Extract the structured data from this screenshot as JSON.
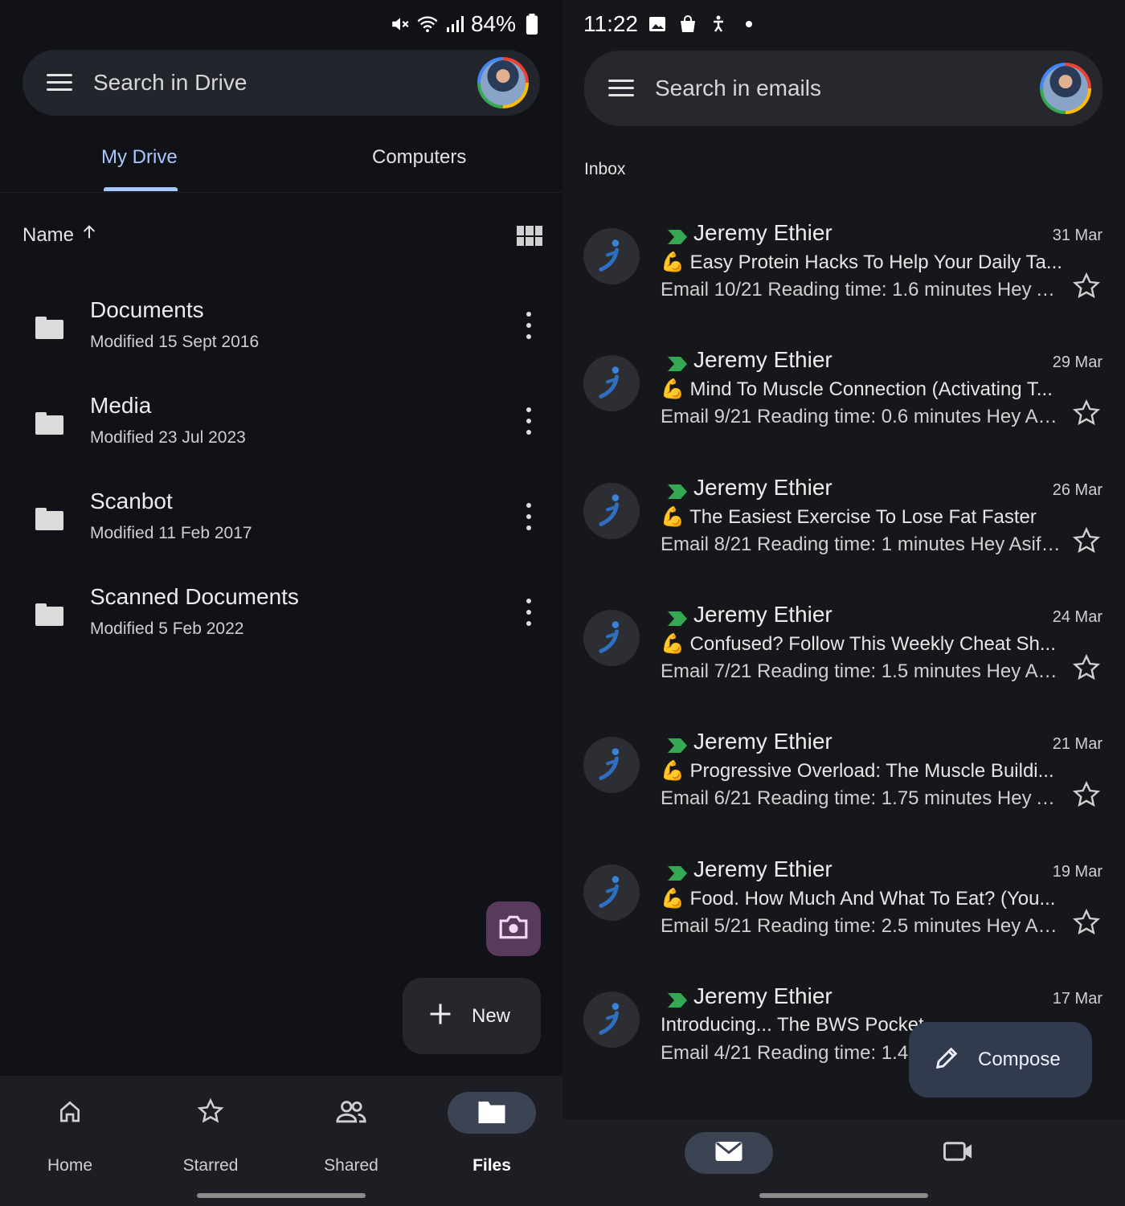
{
  "drive": {
    "status": {
      "battery": "84%"
    },
    "search": {
      "placeholder": "Search in Drive"
    },
    "tabs": [
      {
        "label": "My Drive"
      },
      {
        "label": "Computers"
      }
    ],
    "sort": {
      "label": "Name"
    },
    "files": [
      {
        "name": "Documents",
        "meta": "Modified 15 Sept 2016"
      },
      {
        "name": "Media",
        "meta": "Modified 23 Jul 2023"
      },
      {
        "name": "Scanbot",
        "meta": "Modified 11 Feb 2017"
      },
      {
        "name": "Scanned Documents",
        "meta": "Modified 5 Feb 2022"
      }
    ],
    "fab": {
      "new_label": "New"
    },
    "nav": [
      {
        "label": "Home",
        "icon": "home-icon"
      },
      {
        "label": "Starred",
        "icon": "star-icon"
      },
      {
        "label": "Shared",
        "icon": "people-icon"
      },
      {
        "label": "Files",
        "icon": "folder-icon"
      }
    ]
  },
  "gmail": {
    "status": {
      "time": "11:22"
    },
    "search": {
      "placeholder": "Search in emails"
    },
    "section": "Inbox",
    "emails": [
      {
        "sender": "Jeremy Ethier",
        "date": "31 Mar",
        "subject": "💪 Easy Protein Hacks To Help Your Daily Ta...",
        "snippet": "Email 10/21 Reading time: 1.6 minutes Hey A..."
      },
      {
        "sender": "Jeremy Ethier",
        "date": "29 Mar",
        "subject": "💪 Mind To Muscle Connection (Activating T...",
        "snippet": "Email 9/21 Reading time: 0.6 minutes Hey As..."
      },
      {
        "sender": "Jeremy Ethier",
        "date": "26 Mar",
        "subject": "💪 The Easiest Exercise To Lose Fat Faster",
        "snippet": "Email 8/21 Reading time: 1 minutes Hey Asif,..."
      },
      {
        "sender": "Jeremy Ethier",
        "date": "24 Mar",
        "subject": "💪 Confused? Follow This Weekly Cheat Sh...",
        "snippet": "Email 7/21 Reading time: 1.5 minutes Hey Asi..."
      },
      {
        "sender": "Jeremy Ethier",
        "date": "21 Mar",
        "subject": "💪 Progressive Overload: The Muscle Buildi...",
        "snippet": "Email 6/21 Reading time: 1.75 minutes Hey A..."
      },
      {
        "sender": "Jeremy Ethier",
        "date": "19 Mar",
        "subject": "💪 Food. How Much And What To Eat? (You...",
        "snippet": "Email 5/21 Reading time: 2.5 minutes Hey Asi..."
      },
      {
        "sender": "Jeremy Ethier",
        "date": "17 Mar",
        "subject": "Introducing... The BWS Pocket",
        "snippet": "Email 4/21 Reading time: 1.4 r"
      }
    ],
    "fab": {
      "compose_label": "Compose"
    }
  },
  "colors": {
    "accent": "#a8c7fa",
    "drive_bg": "#101218",
    "gmail_bg": "#16171b"
  }
}
